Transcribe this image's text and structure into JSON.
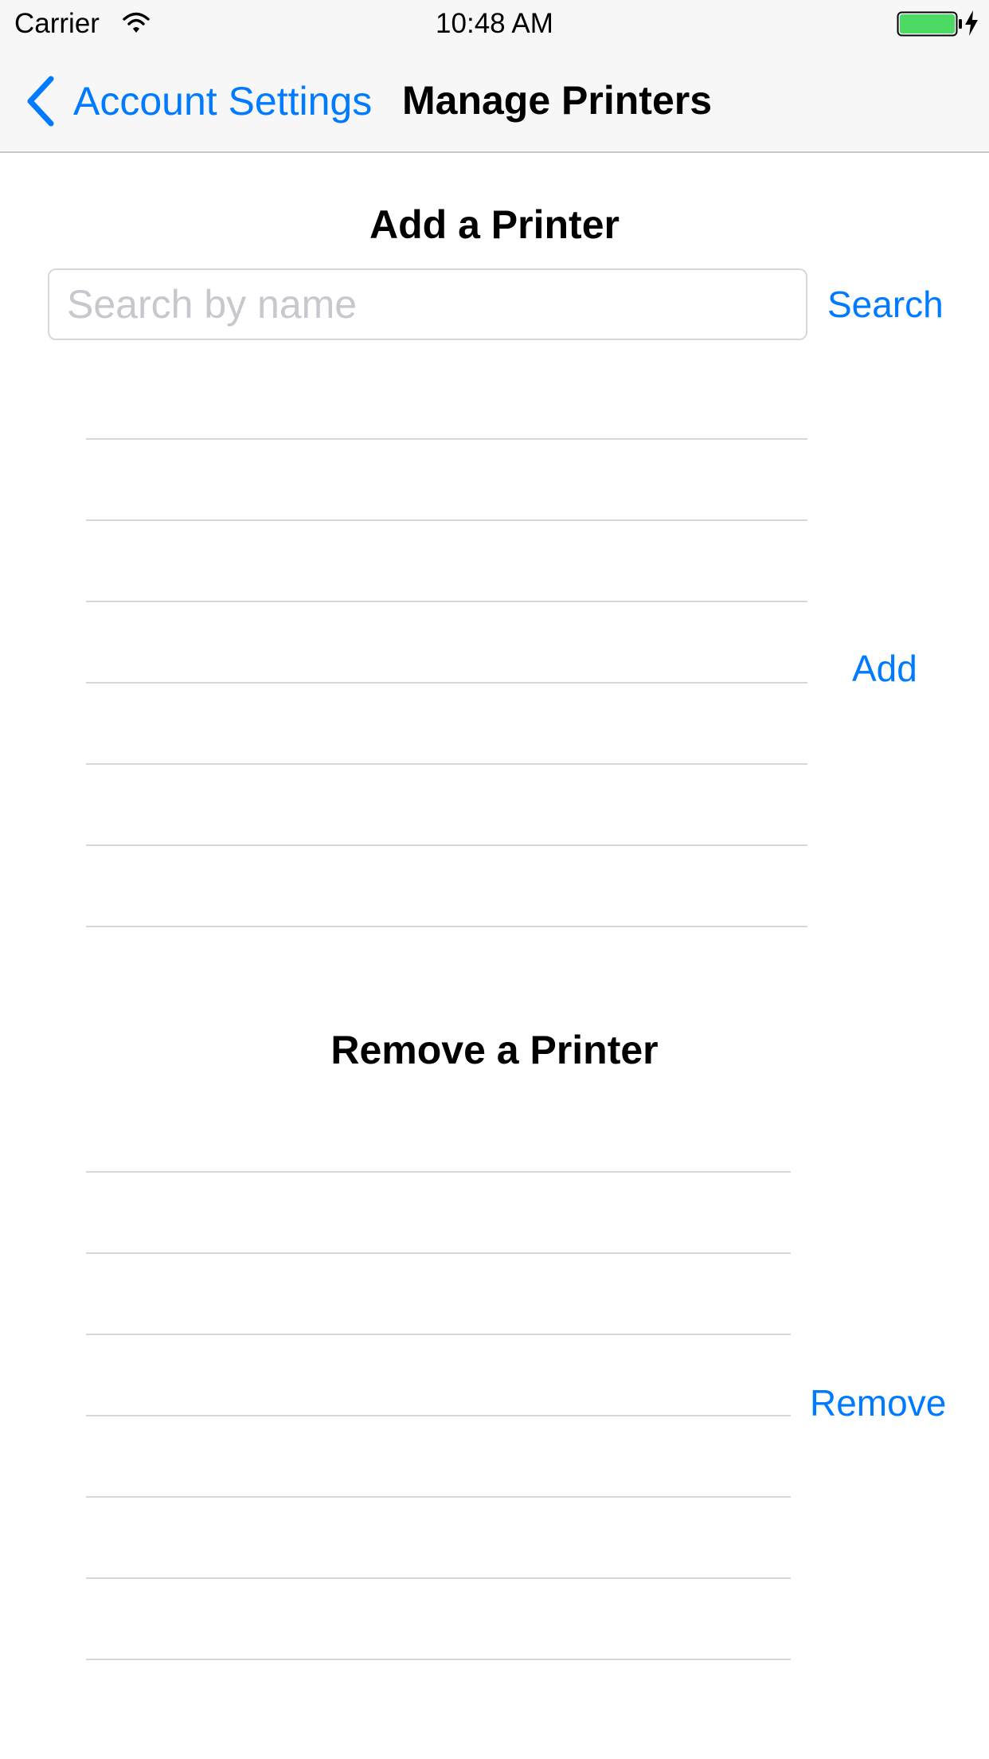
{
  "status_bar": {
    "carrier": "Carrier",
    "time": "10:48 AM",
    "wifi_icon": "wifi-icon",
    "battery_icon": "battery-icon",
    "charging_icon": "charging-bolt-icon",
    "battery_level": 1.0,
    "battery_color": "#4cd964"
  },
  "nav_bar": {
    "back_label": "Account Settings",
    "back_icon": "chevron-left-icon",
    "title": "Manage Printers"
  },
  "add_section": {
    "title": "Add a Printer",
    "search_placeholder": "Search by name",
    "search_value": "",
    "search_button": "Search",
    "add_button": "Add",
    "rows": [
      "",
      "",
      "",
      "",
      "",
      "",
      ""
    ]
  },
  "remove_section": {
    "title": "Remove a Printer",
    "remove_button": "Remove",
    "rows": [
      "",
      "",
      "",
      "",
      "",
      "",
      ""
    ]
  },
  "colors": {
    "accent": "#007aff",
    "bar_background": "#f7f7f7",
    "separator": "#d6d6d9",
    "placeholder": "#c7c7cd"
  }
}
